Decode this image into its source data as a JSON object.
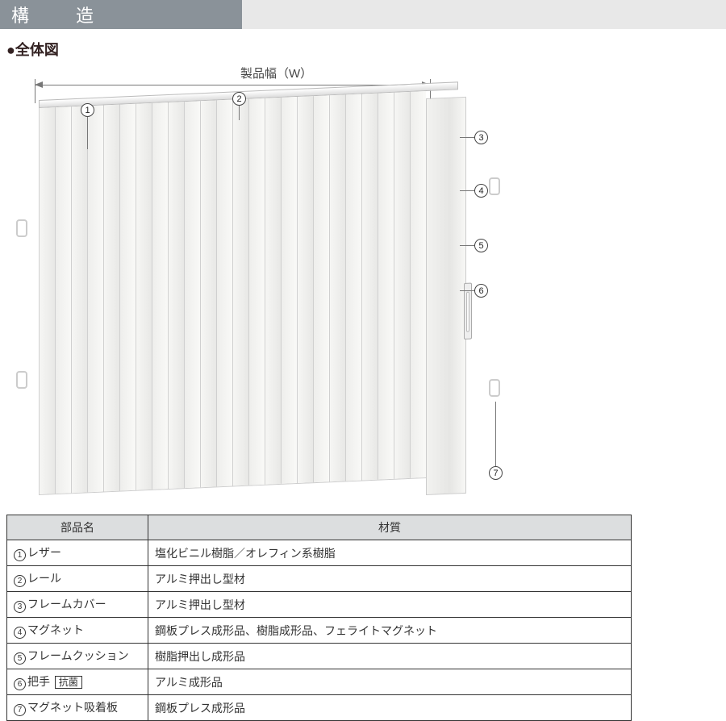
{
  "title": "構　造",
  "subtitle": "●全体図",
  "width_label": "製品幅（W）",
  "callouts": {
    "c1": "1",
    "c2": "2",
    "c3": "3",
    "c4": "4",
    "c5": "5",
    "c6": "6",
    "c7": "7"
  },
  "table": {
    "headers": {
      "name": "部品名",
      "material": "材質"
    },
    "rows": [
      {
        "num": "1",
        "name": "レザー",
        "material": "塩化ビニル樹脂／オレフィン系樹脂"
      },
      {
        "num": "2",
        "name": "レール",
        "material": "アルミ押出し型材"
      },
      {
        "num": "3",
        "name": "フレームカバー",
        "material": "アルミ押出し型材"
      },
      {
        "num": "4",
        "name": "マグネット",
        "material": "鋼板プレス成形品、樹脂成形品、フェライトマグネット"
      },
      {
        "num": "5",
        "name": "フレームクッション",
        "material": "樹脂押出し成形品"
      },
      {
        "num": "6",
        "name": "把手",
        "tag": "抗菌",
        "material": "アルミ成形品"
      },
      {
        "num": "7",
        "name": "マグネット吸着板",
        "material": "鋼板プレス成形品"
      }
    ]
  }
}
